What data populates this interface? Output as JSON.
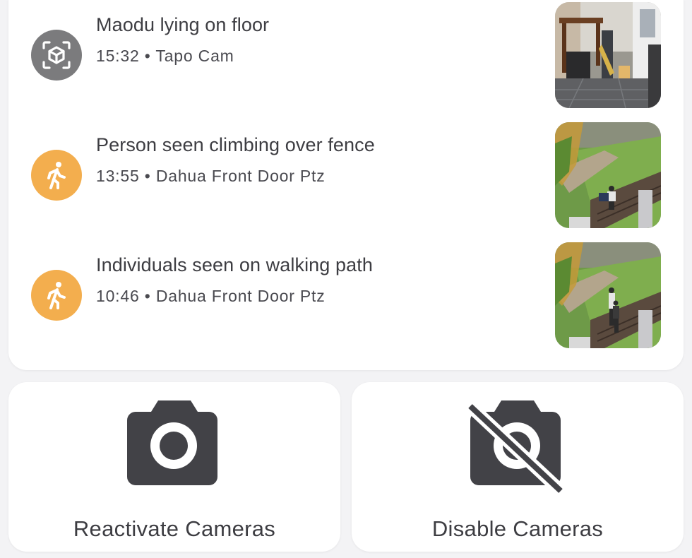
{
  "events": [
    {
      "title": "Maodu lying on floor",
      "time": "15:32",
      "separator": "•",
      "camera": "Tapo Cam",
      "icon": "object-detection-icon",
      "icon_color": "#7b7b7d"
    },
    {
      "title": "Person seen climbing over fence",
      "time": "13:55",
      "separator": "•",
      "camera": "Dahua Front Door Ptz",
      "icon": "walking-person-icon",
      "icon_color": "#f3ae4e"
    },
    {
      "title": "Individuals seen on walking path",
      "time": "10:46",
      "separator": "•",
      "camera": "Dahua Front Door Ptz",
      "icon": "walking-person-icon",
      "icon_color": "#f3ae4e"
    }
  ],
  "actions": {
    "reactivate_label": "Reactivate Cameras",
    "disable_label": "Disable Cameras"
  },
  "colors": {
    "text": "#3d3d42",
    "icon_dark": "#424247",
    "accent_orange": "#f3ae4e",
    "neutral_gray": "#7b7b7d"
  }
}
